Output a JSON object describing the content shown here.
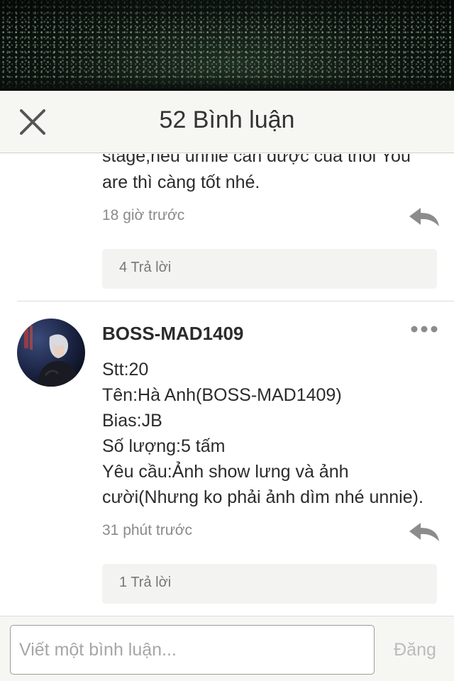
{
  "header": {
    "title": "52 Bình luận"
  },
  "comments": [
    {
      "lines": [
        "stage,nếu unnie cần được của thôi You",
        "are thì càng tốt nhé."
      ],
      "time": "18 giờ trước",
      "replies_label": "4 Trả lời"
    },
    {
      "username": "BOSS-MAD1409",
      "lines": [
        "Stt:20",
        "Tên:Hà Anh(BOSS-MAD1409)",
        "Bias:JB",
        "Số lượng:5 tấm",
        "Yêu cầu:Ảnh show lưng và ảnh",
        "cười(Nhưng ko phải ảnh dìm nhé unnie)."
      ],
      "time": "31 phút trước",
      "replies_label": "1 Trả lời"
    }
  ],
  "footer": {
    "input_placeholder": "Viết một bình luận...",
    "post_label": "Đăng"
  },
  "colors": {
    "header_bg": "#f6f6f3",
    "icon_gray": "#8c8c8c",
    "muted_text": "#8a8a8a"
  }
}
